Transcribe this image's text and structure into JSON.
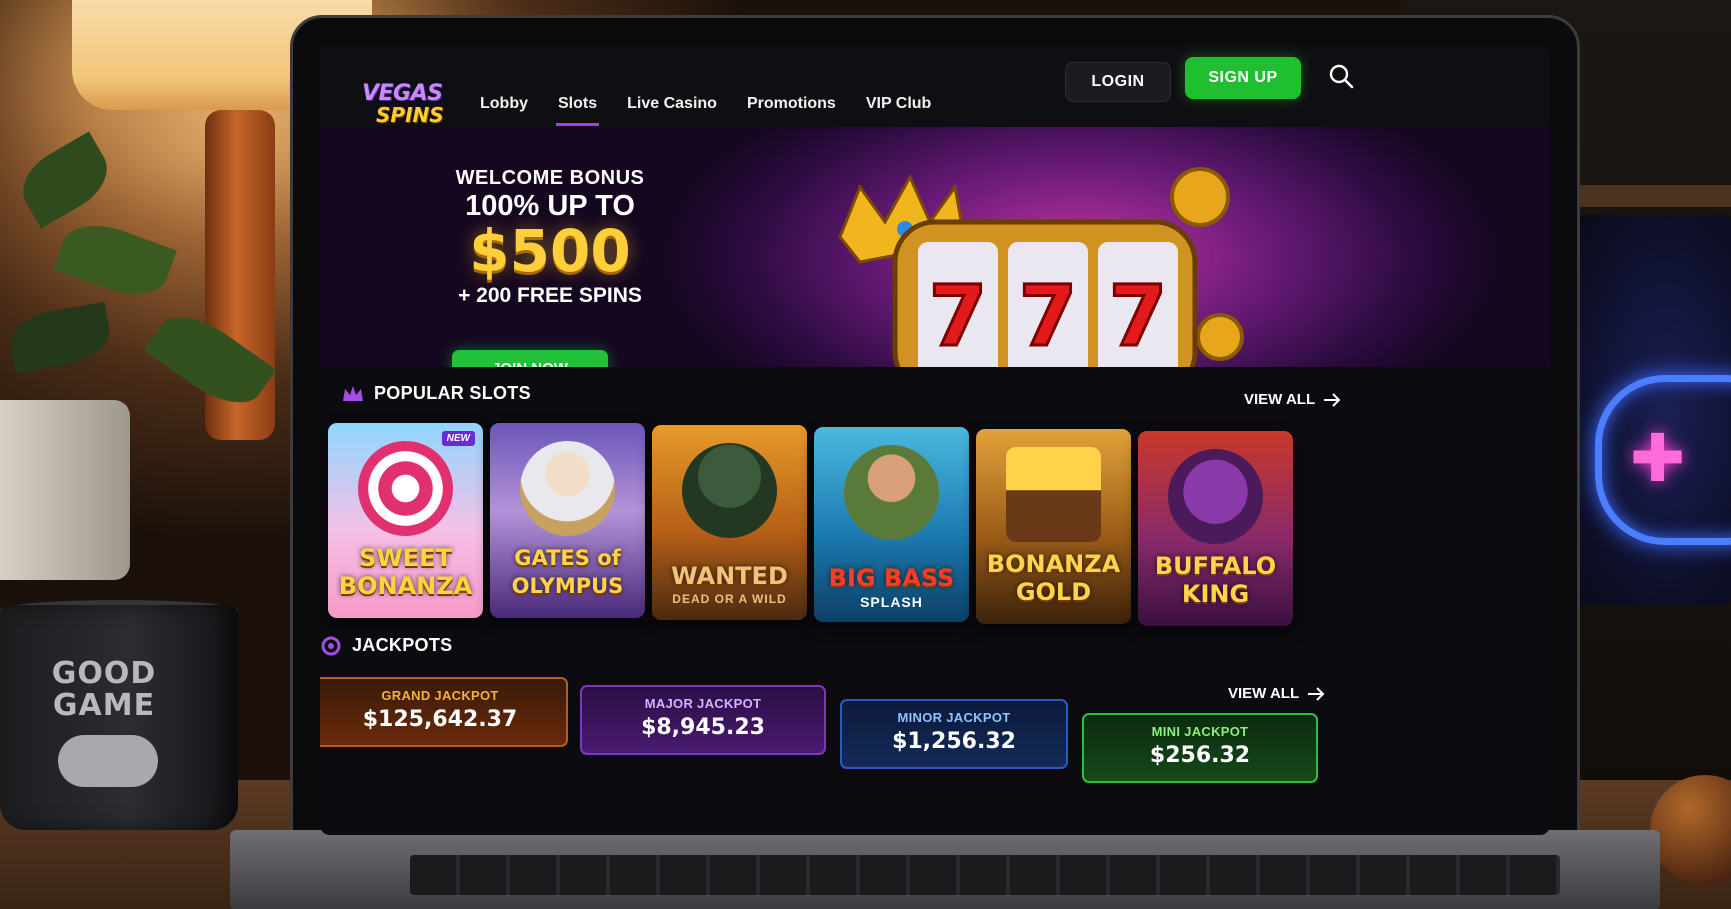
{
  "decor": {
    "mug_text": "GOOD GAME"
  },
  "header": {
    "logo_top": "VEGAS",
    "logo_bottom": "SPINS",
    "nav": [
      {
        "label": "Lobby"
      },
      {
        "label": "Slots",
        "active": true
      },
      {
        "label": "Live Casino"
      },
      {
        "label": "Promotions"
      },
      {
        "label": "VIP Club"
      }
    ],
    "login_label": "LOGIN",
    "signup_label": "SIGN UP",
    "search_icon": "search-icon"
  },
  "hero": {
    "line1": "WELCOME BONUS",
    "line2": "100% UP TO",
    "amount": "$500",
    "line4": "+ 200 FREE SPINS",
    "cta_label": "JOIN NOW",
    "reel_symbols": [
      "7",
      "7",
      "7"
    ]
  },
  "popular": {
    "title": "POPULAR SLOTS",
    "icon": "crown-icon",
    "view_all": "VIEW ALL",
    "games": [
      {
        "name": "SWEET BONANZA",
        "badge": "NEW",
        "subtitle": ""
      },
      {
        "name": "GATES of OLYMPUS",
        "subtitle": ""
      },
      {
        "name": "WANTED",
        "subtitle": "DEAD OR A WILD"
      },
      {
        "name": "BIG BASS",
        "subtitle": "SPLASH"
      },
      {
        "name": "BONANZA GOLD",
        "subtitle": ""
      },
      {
        "name": "BUFFALO KING",
        "subtitle": ""
      }
    ]
  },
  "jackpots": {
    "title": "JACKPOTS",
    "icon": "jackpot-icon",
    "view_all": "VIEW ALL",
    "items": [
      {
        "label": "GRAND JACKPOT",
        "value": "$125,642.37",
        "color": "#f0b23a"
      },
      {
        "label": "MAJOR JACKPOT",
        "value": "$8,945.23",
        "color": "#d7b3ff"
      },
      {
        "label": "MINOR JACKPOT",
        "value": "$1,256.32",
        "color": "#8fc2ff"
      },
      {
        "label": "MINI JACKPOT",
        "value": "$256.32",
        "color": "#8cf07a"
      }
    ]
  },
  "colors": {
    "accent": "#a93cf0",
    "cta_green": "#21c23a",
    "gold": "#ffcf3a"
  }
}
